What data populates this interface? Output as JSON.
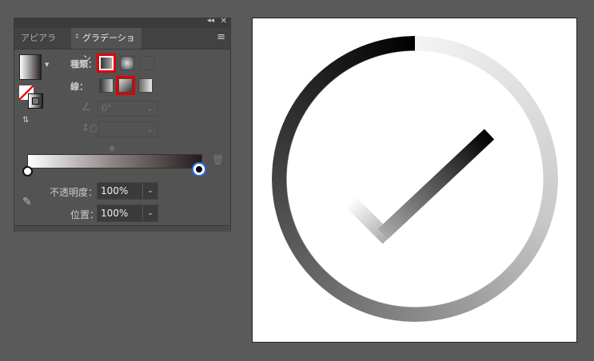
{
  "panel": {
    "tabs": [
      {
        "label": "アピアランス"
      },
      {
        "label": "グラデーション"
      }
    ],
    "type_label": "種類：",
    "stroke_label": "線：",
    "angle_value": "0°",
    "opacity_label": "不透明度：",
    "opacity_value": "100%",
    "position_label": "位置：",
    "position_value": "100%"
  },
  "colors": {
    "highlight": "#e00000",
    "stop_selected": "#2d6fe0"
  }
}
